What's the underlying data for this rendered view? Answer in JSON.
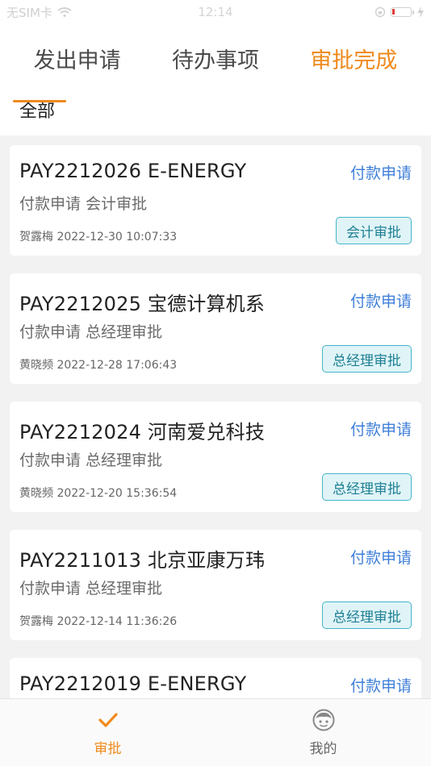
{
  "status_bar": {
    "carrier": "无SIM卡",
    "time": "12:14",
    "battery_color": "#e23b3b"
  },
  "tabs": [
    {
      "label": "发出申请",
      "active": false
    },
    {
      "label": "待办事项",
      "active": false
    },
    {
      "label": "审批完成",
      "active": true
    }
  ],
  "filter": {
    "label": "全部"
  },
  "accent_color": "#f08a1c",
  "link_color": "#3f7fd9",
  "cards": [
    {
      "title": "PAY2212026 E-ENERGY",
      "type": "付款申请",
      "subtitle": "付款申请 会计审批",
      "meta": "贺露梅 2022-12-30 10:07:33",
      "badge": "会计审批"
    },
    {
      "title": "PAY2212025 宝德计算机系",
      "type": "付款申请",
      "subtitle": "付款申请 总经理审批",
      "meta": "黄晓频 2022-12-28 17:06:43",
      "badge": "总经理审批"
    },
    {
      "title": "PAY2212024 河南爱兑科技",
      "type": "付款申请",
      "subtitle": "付款申请 总经理审批",
      "meta": "黄晓频 2022-12-20 15:36:54",
      "badge": "总经理审批"
    },
    {
      "title": "PAY2211013 北京亚康万玮",
      "type": "付款申请",
      "subtitle": "付款申请 总经理审批",
      "meta": "贺露梅 2022-12-14 11:36:26",
      "badge": "总经理审批"
    },
    {
      "title": "PAY2212019 E-ENERGY",
      "type": "付款申请",
      "subtitle": "",
      "meta": "",
      "badge": ""
    }
  ],
  "bottom_nav": [
    {
      "label": "审批",
      "icon": "check-icon",
      "active": true
    },
    {
      "label": "我的",
      "icon": "face-icon",
      "active": false
    }
  ]
}
